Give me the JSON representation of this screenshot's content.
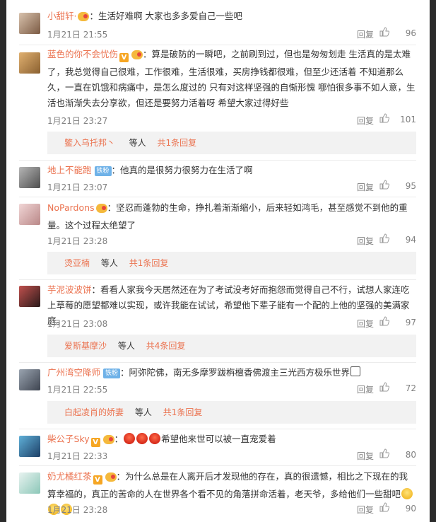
{
  "comments": [
    {
      "user": "小甜轩·",
      "badges": "vip",
      "text": "生活好难啊 大家也多多爱自己一些吧",
      "time": "1月21日 21:55",
      "reply": "回复",
      "likes": "96",
      "sub": null
    },
    {
      "user": "蓝色的你不会忧伤",
      "badges": "v-vip",
      "text": "算是破防的一瞬吧，之前刷到过，但也是匆匆划走 生活真的是太难了，我总觉得自己很难，工作很难，生活很难，买房挣钱都很难，但至少还活着 不知道那么久，一直在饥饿和病痛中，是怎么度过的 只有对这样坚强的自惭形愧 哪怕很多事不如人意，生活也渐渐失去分享欲，但还是要努力活着呀 希望大家过得好些",
      "time": "1月21日 23:27",
      "reply": "回复",
      "likes": "101",
      "sub": {
        "name": "鳖入乌托邦丶",
        "suffix": "等人",
        "count": "共1条回复"
      }
    },
    {
      "user": "地上不能跑",
      "badges": "fan",
      "fan_label": "铁粉",
      "text": "他真的是很努力很努力在生活了啊",
      "time": "1月21日 23:07",
      "reply": "回复",
      "likes": "95",
      "sub": null
    },
    {
      "user": "NoPardons",
      "badges": "vip",
      "text": "坚忍而蓬勃的生命，挣扎着渐渐缩小，后来轻如鸿毛，甚至感觉不到他的重量。这个过程太绝望了",
      "time": "1月21日 23:28",
      "reply": "回复",
      "likes": "94",
      "sub": {
        "name": "烫亚楠",
        "suffix": "等人",
        "count": "共1条回复"
      }
    },
    {
      "user": "芋泥波波饼",
      "badges": "",
      "text": "看看人家我今天居然还在为了考试没考好而抱怨而觉得自己不行，试想人家连吃上草莓的愿望都难以实现，或许我能在试试，希望他下辈子能有一个配的上他的坚强的美满家庭。",
      "time": "1月21日 23:08",
      "reply": "回复",
      "likes": "97",
      "sub": {
        "name": "爱斯基摩沙",
        "suffix": "等人",
        "count": "共4条回复"
      }
    },
    {
      "user": "广州湾空降师",
      "badges": "fan",
      "fan_label": "铁粉",
      "text": "阿弥陀佛，南无多摩罗跋栴檀香佛渡主三光西方极乐世界",
      "time": "1月21日 22:55",
      "reply": "回复",
      "likes": "72",
      "sub": {
        "name": "白起凌肖的娇妻",
        "suffix": "等人",
        "count": "共1条回复"
      }
    },
    {
      "user": "柴公子Sky",
      "badges": "v-vip",
      "text": "希望他来世可以被一直宠爱着",
      "time": "1月21日 22:33",
      "reply": "回复",
      "likes": "80",
      "sub": null
    },
    {
      "user": "奶尤橘红茶",
      "badges": "v-vip",
      "text": "为什么总是在人离开后才发现他的存在，真的很遗憾，相比之下现在的我算幸福的，真正的苦命的人在世界各个看不见的角落拼命活着，老天爷，多给他们一些甜吧",
      "time": "1月21日 23:28",
      "reply": "回复",
      "likes": "90",
      "sub": null
    }
  ],
  "icons": {
    "like": "thumbs-up-icon",
    "verified": "v-badge-icon",
    "vip": "vip-badge-icon"
  },
  "colors": {
    "username": "#eb7350",
    "meta": "#808080",
    "subbox": "#f2f2f2"
  }
}
